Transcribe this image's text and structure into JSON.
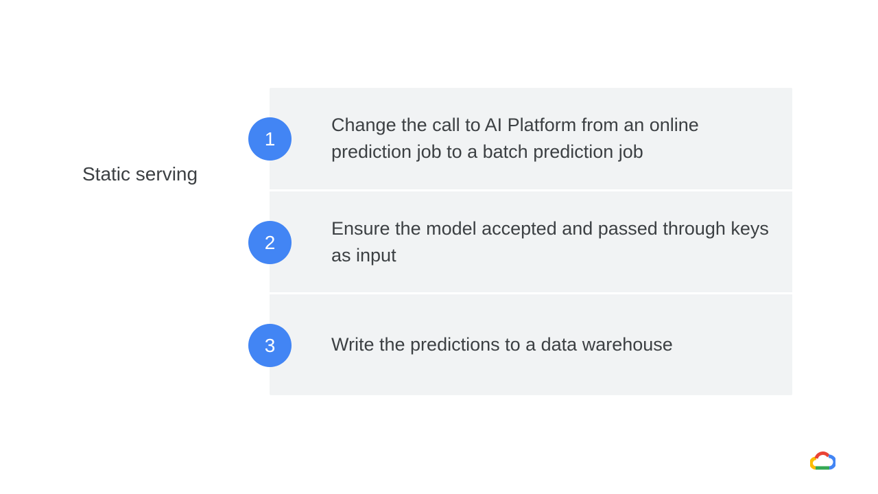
{
  "slide": {
    "label": "Static serving"
  },
  "steps": [
    {
      "number": "1",
      "text": "Change the call to AI Platform from an online prediction job to a batch prediction job"
    },
    {
      "number": "2",
      "text": "Ensure the model accepted and passed through keys as input"
    },
    {
      "number": "3",
      "text": "Write the predictions to a data warehouse"
    }
  ],
  "colors": {
    "badge": "#4285f4",
    "panel": "#f1f3f4",
    "text": "#3c4043",
    "logo_blue": "#4285f4",
    "logo_red": "#ea4335",
    "logo_yellow": "#fbbc04",
    "logo_green": "#34a853"
  },
  "icons": {
    "logo": "google-cloud-logo-icon"
  }
}
